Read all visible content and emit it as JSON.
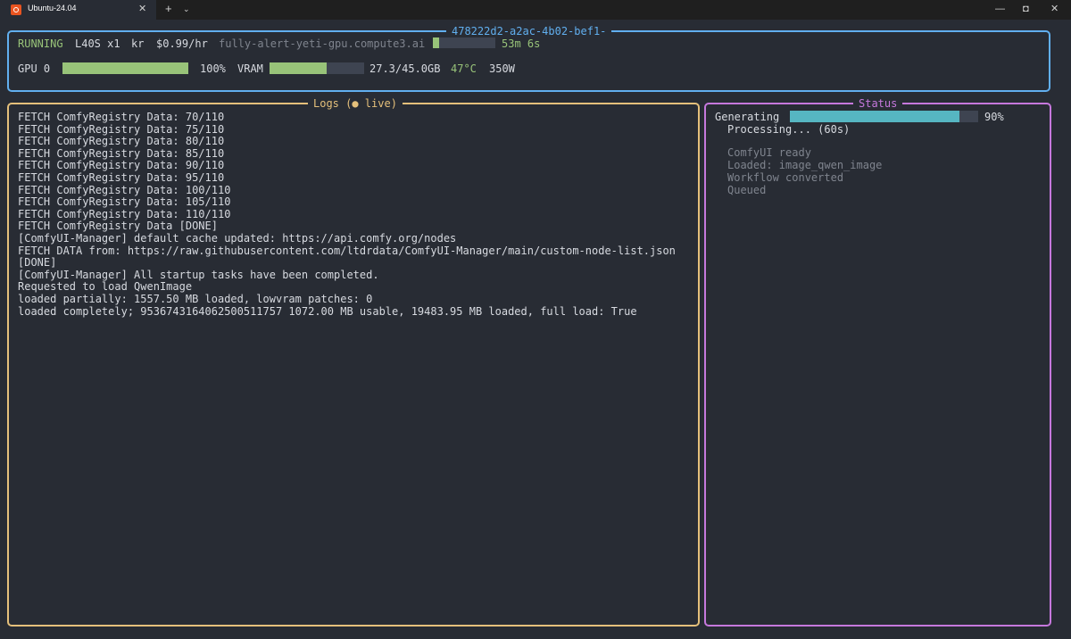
{
  "window": {
    "tab_title": "Ubuntu-24.04",
    "tab_close": "✕",
    "new_tab": "+",
    "tab_dropdown": "⌄",
    "minimize": "—",
    "maximize": "◘",
    "close": "✕"
  },
  "instance": {
    "id": "478222d2-a2ac-4b02-bef1-",
    "state": "RUNNING",
    "gpu_type": "L40S x1",
    "region": "kr",
    "price": "$0.99/hr",
    "hostname": "fully-alert-yeti-gpu.compute3.ai",
    "uptime_progress": 0.1,
    "uptime": "53m 6s",
    "gpu_label": "GPU 0",
    "gpu_util": 1.0,
    "gpu_util_text": "100%",
    "vram_label": "VRAM",
    "vram_fraction": 0.607,
    "vram_text": "27.3/45.0GB",
    "temp": "47°C",
    "power": "350W"
  },
  "logs": {
    "title": "Logs (● live)",
    "lines": [
      "FETCH ComfyRegistry Data: 70/110",
      "FETCH ComfyRegistry Data: 75/110",
      "FETCH ComfyRegistry Data: 80/110",
      "FETCH ComfyRegistry Data: 85/110",
      "FETCH ComfyRegistry Data: 90/110",
      "FETCH ComfyRegistry Data: 95/110",
      "FETCH ComfyRegistry Data: 100/110",
      "FETCH ComfyRegistry Data: 105/110",
      "FETCH ComfyRegistry Data: 110/110",
      "FETCH ComfyRegistry Data [DONE]",
      "[ComfyUI-Manager] default cache updated: https://api.comfy.org/nodes",
      "FETCH DATA from: https://raw.githubusercontent.com/ltdrdata/ComfyUI-Manager/main/custom-node-list.json",
      "[DONE]",
      "[ComfyUI-Manager] All startup tasks have been completed.",
      "Requested to load QwenImage",
      "loaded partially: 1557.50 MB loaded, lowvram patches: 0",
      "loaded completely; 9536743164062500511757 1072.00 MB usable, 19483.95 MB loaded, full load: True"
    ]
  },
  "status": {
    "title": "Status",
    "label": "Generating",
    "progress": 0.9,
    "progress_text": "90%",
    "detail": "Processing... (60s)",
    "history": [
      "ComfyUI ready",
      "Loaded: image_qwen_image",
      "Workflow converted",
      "Queued"
    ]
  },
  "colors": {
    "blue": "#61afef",
    "green": "#98c379",
    "yellow": "#e5c07b",
    "purple": "#c678dd",
    "cyan": "#56b6c2",
    "gray": "#7f848e"
  }
}
